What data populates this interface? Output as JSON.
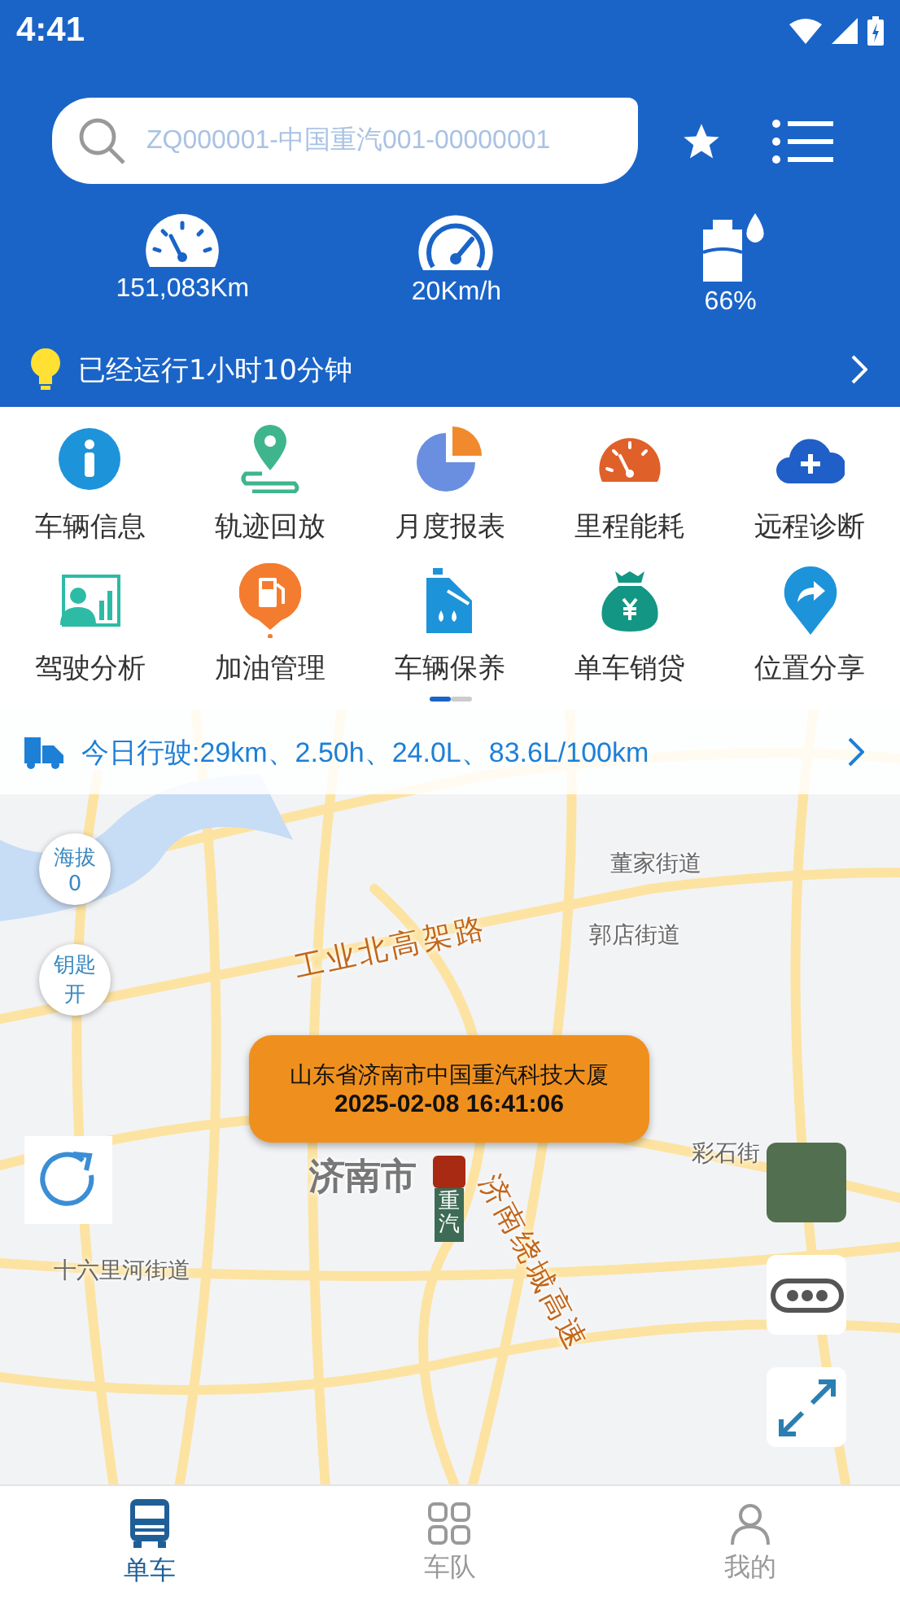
{
  "status_bar": {
    "time": "4:41"
  },
  "search": {
    "placeholder": "ZQ000001-中国重汽001-00000001"
  },
  "stats": [
    {
      "kind": "odometer",
      "value": "151,083Km"
    },
    {
      "kind": "speed",
      "value": "20Km/h"
    },
    {
      "kind": "fuel",
      "value": "66%"
    }
  ],
  "runtime_banner": {
    "text": "已经运行1小时10分钟"
  },
  "menu": {
    "items": [
      {
        "kind": "info",
        "label": "车辆信息"
      },
      {
        "kind": "track",
        "label": "轨迹回放"
      },
      {
        "kind": "report",
        "label": "月度报表"
      },
      {
        "kind": "gauge",
        "label": "里程能耗"
      },
      {
        "kind": "cloud",
        "label": "远程诊断"
      },
      {
        "kind": "driver",
        "label": "驾驶分析"
      },
      {
        "kind": "fuelpin",
        "label": "加油管理"
      },
      {
        "kind": "oil",
        "label": "车辆保养"
      },
      {
        "kind": "money",
        "label": "单车销贷"
      },
      {
        "kind": "share",
        "label": "位置分享"
      }
    ],
    "pages": [
      {
        "selected": true
      },
      {
        "selected": false
      }
    ]
  },
  "today_summary": {
    "text": "今日行驶:29km、2.50h、24.0L、83.6L/100km"
  },
  "map": {
    "labels": [
      {
        "kind": "district",
        "text": "董家街道"
      },
      {
        "kind": "district",
        "text": "郭店街道"
      },
      {
        "kind": "road",
        "text": "工业北高架路"
      },
      {
        "kind": "city",
        "text": "济南市"
      },
      {
        "kind": "district",
        "text": "彩石街"
      },
      {
        "kind": "district",
        "text": "十六里河街道"
      },
      {
        "kind": "road",
        "text": "济南绕城高速"
      }
    ],
    "badges": [
      {
        "label": "海拔",
        "value": "0"
      },
      {
        "label": "钥匙",
        "value": "开"
      }
    ],
    "popup": {
      "address": "山东省济南市中国重汽科技大厦",
      "time": "2025-02-08 16:41:06"
    },
    "vehicle_tag": "重汽"
  },
  "tabs": [
    {
      "kind": "truck",
      "label": "单车",
      "selected": true
    },
    {
      "kind": "grid",
      "label": "车队",
      "selected": false
    },
    {
      "kind": "person",
      "label": "我的",
      "selected": false
    }
  ]
}
